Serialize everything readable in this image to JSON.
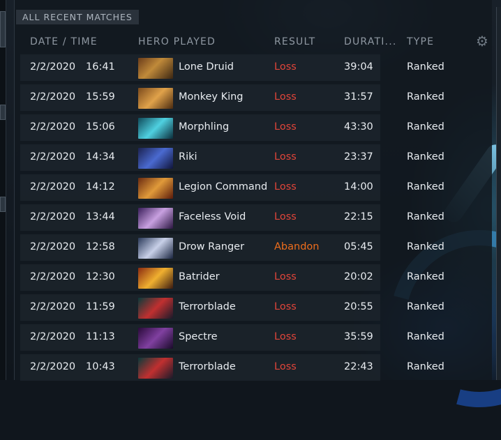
{
  "panel": {
    "title": "ALL RECENT MATCHES"
  },
  "columns": {
    "date_time": "DATE / TIME",
    "hero": "HERO PLAYED",
    "result": "RESULT",
    "duration": "DURATI...",
    "type": "TYPE"
  },
  "icons": {
    "settings": "gear-icon"
  },
  "colors": {
    "loss": "#e0453a",
    "abandon": "#ee6d1c",
    "header": "#8f98a2"
  },
  "matches": [
    {
      "date": "2/2/2020",
      "time": "16:41",
      "hero": "Lone Druid",
      "result": "Loss",
      "duration": "39:04",
      "type": "Ranked"
    },
    {
      "date": "2/2/2020",
      "time": "15:59",
      "hero": "Monkey King",
      "result": "Loss",
      "duration": "31:57",
      "type": "Ranked"
    },
    {
      "date": "2/2/2020",
      "time": "15:06",
      "hero": "Morphling",
      "result": "Loss",
      "duration": "43:30",
      "type": "Ranked"
    },
    {
      "date": "2/2/2020",
      "time": "14:34",
      "hero": "Riki",
      "result": "Loss",
      "duration": "23:37",
      "type": "Ranked"
    },
    {
      "date": "2/2/2020",
      "time": "14:12",
      "hero": "Legion Commander",
      "result": "Loss",
      "duration": "14:00",
      "type": "Ranked"
    },
    {
      "date": "2/2/2020",
      "time": "13:44",
      "hero": "Faceless Void",
      "result": "Loss",
      "duration": "22:15",
      "type": "Ranked"
    },
    {
      "date": "2/2/2020",
      "time": "12:58",
      "hero": "Drow Ranger",
      "result": "Abandon",
      "duration": "05:45",
      "type": "Ranked"
    },
    {
      "date": "2/2/2020",
      "time": "12:30",
      "hero": "Batrider",
      "result": "Loss",
      "duration": "20:02",
      "type": "Ranked"
    },
    {
      "date": "2/2/2020",
      "time": "11:59",
      "hero": "Terrorblade",
      "result": "Loss",
      "duration": "20:55",
      "type": "Ranked"
    },
    {
      "date": "2/2/2020",
      "time": "11:13",
      "hero": "Spectre",
      "result": "Loss",
      "duration": "35:59",
      "type": "Ranked"
    },
    {
      "date": "2/2/2020",
      "time": "10:43",
      "hero": "Terrorblade",
      "result": "Loss",
      "duration": "22:43",
      "type": "Ranked"
    }
  ]
}
